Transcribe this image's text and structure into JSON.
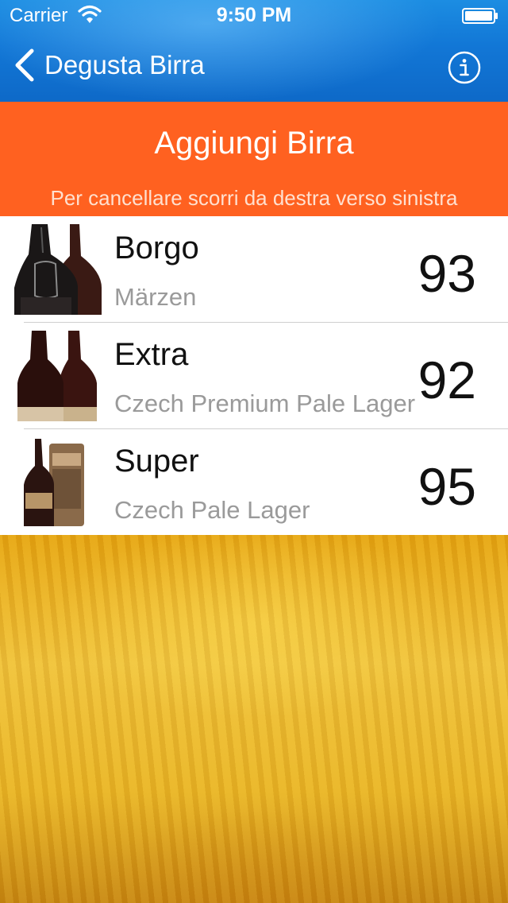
{
  "status_bar": {
    "carrier": "Carrier",
    "time": "9:50 PM"
  },
  "nav": {
    "back_label": "Degusta Birra",
    "info_icon": "info-circle-icon"
  },
  "header": {
    "title": "Aggiungi Birra",
    "hint": "Per cancellare scorri da destra verso sinistra"
  },
  "beers": [
    {
      "name": "Borgo",
      "style": "Märzen",
      "score": "93"
    },
    {
      "name": "Extra",
      "style": "Czech Premium Pale Lager",
      "score": "92"
    },
    {
      "name": "Super",
      "style": "Czech Pale Lager",
      "score": "95"
    }
  ],
  "colors": {
    "nav_blue": "#1277d6",
    "header_orange": "#ff6120",
    "background_amber": "#e9b21c"
  }
}
